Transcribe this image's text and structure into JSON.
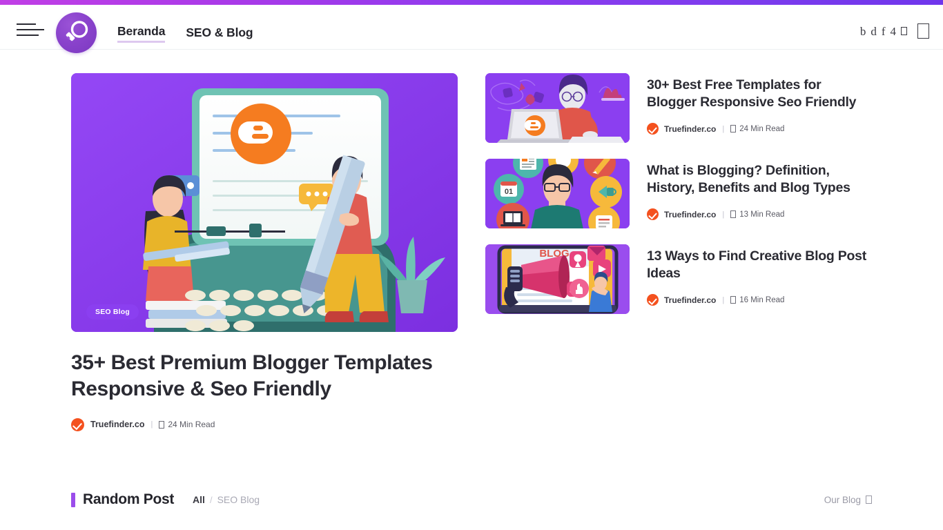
{
  "theme": {
    "accent_purple": "#8b3ff0",
    "gradient_left": "#c13fe6",
    "gradient_right": "#6f35ec",
    "check_orange": "#f4511e",
    "text_dark": "#2b2b33"
  },
  "header": {
    "menu_icon": "hamburger-icon",
    "logo_icon": "magnifier-logo-icon",
    "nav": [
      {
        "label": "Beranda",
        "active": true
      },
      {
        "label": "SEO & Blog",
        "active": false
      }
    ],
    "right_icons": [
      "b",
      "d",
      "f",
      "4"
    ],
    "right_tofu_small": "missing-glyph-box",
    "right_tofu_large": "missing-glyph-box"
  },
  "featured": {
    "badge": "SEO Blog",
    "title": "35+ Best Premium Blogger Templates Responsive & Seo Friendly",
    "author": "Truefinder.co",
    "separator": "|",
    "read_time": "24 Min Read",
    "image_alt": "blogger-templates-illustration"
  },
  "sidebar": {
    "posts": [
      {
        "title": "30+ Best Free Templates for Blogger Responsive Seo Friendly",
        "author": "Truefinder.co",
        "read_time": "24 Min Read",
        "thumb_alt": "person-at-laptop-blogger-illustration"
      },
      {
        "title": "What is Blogging? Definition, History, Benefits and Blog Types",
        "author": "Truefinder.co",
        "read_time": "13 Min Read",
        "thumb_alt": "person-with-icon-circles-illustration"
      },
      {
        "title": "13 Ways to Find Creative Blog Post Ideas",
        "author": "Truefinder.co",
        "read_time": "16 Min Read",
        "thumb_alt": "megaphone-blog-promotion-illustration"
      }
    ]
  },
  "random_post": {
    "heading": "Random Post",
    "filter_all": "All",
    "filter_slash": "/",
    "filter_seo": "SEO Blog",
    "right_label": "Our Blog"
  }
}
